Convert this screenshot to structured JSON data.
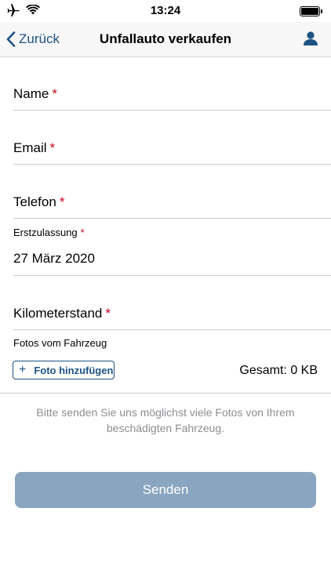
{
  "status_bar": {
    "time": "13:24",
    "icons": [
      "airplane-icon",
      "wifi-icon",
      "battery-icon"
    ]
  },
  "nav": {
    "back_label": "Zurück",
    "title": "Unfallauto verkaufen",
    "user_icon": "user-icon"
  },
  "form": {
    "required_marker": "*",
    "name_label": "Name",
    "email_label": "Email",
    "phone_label": "Telefon",
    "registration_label": "Erstzulassung",
    "registration_value": "27 März 2020",
    "mileage_label": "Kilometerstand",
    "photos_label": "Fotos vom Fahrzeug",
    "add_photo_label": "Foto hinzufügen",
    "total_label": "Gesamt: 0 KB"
  },
  "hint": "Bitte senden Sie uns möglichst viele Fotos von Ihrem beschädigten Fahrzeug.",
  "send_label": "Senden",
  "colors": {
    "accent": "#1c5384",
    "required": "#d0021b",
    "button_disabled": "#8aa5c0",
    "hint_text": "#8e8e93"
  }
}
